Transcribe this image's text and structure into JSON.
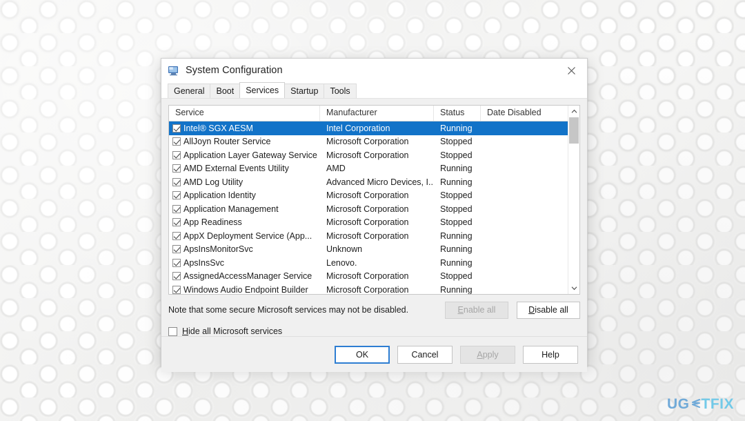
{
  "window": {
    "title": "System Configuration",
    "icon": "system-configuration-icon",
    "close_label": "✕"
  },
  "tabs": [
    {
      "label": "General",
      "active": false
    },
    {
      "label": "Boot",
      "active": false
    },
    {
      "label": "Services",
      "active": true
    },
    {
      "label": "Startup",
      "active": false
    },
    {
      "label": "Tools",
      "active": false
    }
  ],
  "services_table": {
    "columns": [
      "Service",
      "Manufacturer",
      "Status",
      "Date Disabled"
    ],
    "rows": [
      {
        "checked": true,
        "service": "Intel® SGX AESM",
        "manufacturer": "Intel Corporation",
        "status": "Running",
        "date_disabled": "",
        "selected": true
      },
      {
        "checked": true,
        "service": "AllJoyn Router Service",
        "manufacturer": "Microsoft Corporation",
        "status": "Stopped",
        "date_disabled": "",
        "selected": false
      },
      {
        "checked": true,
        "service": "Application Layer Gateway Service",
        "manufacturer": "Microsoft Corporation",
        "status": "Stopped",
        "date_disabled": "",
        "selected": false
      },
      {
        "checked": true,
        "service": "AMD External Events Utility",
        "manufacturer": "AMD",
        "status": "Running",
        "date_disabled": "",
        "selected": false
      },
      {
        "checked": true,
        "service": "AMD Log Utility",
        "manufacturer": "Advanced Micro Devices, I...",
        "status": "Running",
        "date_disabled": "",
        "selected": false
      },
      {
        "checked": true,
        "service": "Application Identity",
        "manufacturer": "Microsoft Corporation",
        "status": "Stopped",
        "date_disabled": "",
        "selected": false
      },
      {
        "checked": true,
        "service": "Application Management",
        "manufacturer": "Microsoft Corporation",
        "status": "Stopped",
        "date_disabled": "",
        "selected": false
      },
      {
        "checked": true,
        "service": "App Readiness",
        "manufacturer": "Microsoft Corporation",
        "status": "Stopped",
        "date_disabled": "",
        "selected": false
      },
      {
        "checked": true,
        "service": "AppX Deployment Service (App...",
        "manufacturer": "Microsoft Corporation",
        "status": "Running",
        "date_disabled": "",
        "selected": false
      },
      {
        "checked": true,
        "service": "ApsInsMonitorSvc",
        "manufacturer": "Unknown",
        "status": "Running",
        "date_disabled": "",
        "selected": false
      },
      {
        "checked": true,
        "service": "ApsInsSvc",
        "manufacturer": "Lenovo.",
        "status": "Running",
        "date_disabled": "",
        "selected": false
      },
      {
        "checked": true,
        "service": "AssignedAccessManager Service",
        "manufacturer": "Microsoft Corporation",
        "status": "Stopped",
        "date_disabled": "",
        "selected": false
      },
      {
        "checked": true,
        "service": "Windows Audio Endpoint Builder",
        "manufacturer": "Microsoft Corporation",
        "status": "Running",
        "date_disabled": "",
        "selected": false
      }
    ]
  },
  "note": "Note that some secure Microsoft services may not be disabled.",
  "buttons": {
    "enable_all": "Enable all",
    "enable_all_disabled": true,
    "disable_all": "Disable all",
    "disable_all_accel": "D",
    "ok": "OK",
    "cancel": "Cancel",
    "apply": "Apply",
    "apply_disabled": true,
    "apply_accel": "A",
    "help": "Help"
  },
  "hide_ms_services": {
    "label": "Hide all Microsoft services",
    "accel": "H",
    "checked": false
  },
  "watermark": {
    "part_a": "UG",
    "part_b": "TFIX"
  },
  "colors": {
    "selection_blue": "#1273c8",
    "focus_blue": "#2d7dd2",
    "dialog_bg": "#f0f0f0",
    "watermark_blue": "#6cc8e8"
  }
}
